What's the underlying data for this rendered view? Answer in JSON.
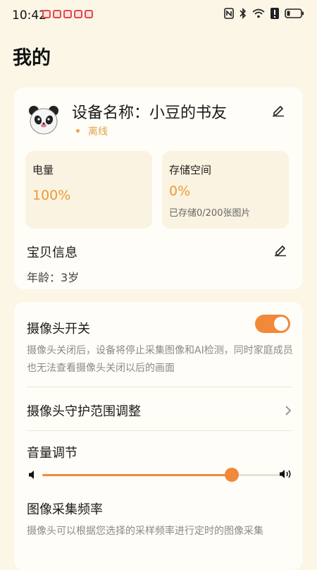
{
  "status_bar": {
    "time": "10:42",
    "icons": [
      "nfc-icon",
      "bluetooth-icon",
      "wifi-icon",
      "alert-icon",
      "battery-icon"
    ]
  },
  "page": {
    "title": "我的"
  },
  "device": {
    "name_label": "设备名称：",
    "name_value": "小豆的书友",
    "status": "离线",
    "battery_label": "电量",
    "battery_value": "100%",
    "storage_label": "存储空间",
    "storage_value": "0%",
    "storage_detail": "已存储0/200张图片"
  },
  "baby": {
    "title": "宝贝信息",
    "age": "年龄：3岁"
  },
  "settings": {
    "camera_switch_title": "摄像头开关",
    "camera_switch_on": true,
    "camera_switch_desc": "摄像头关闭后，设备将停止采集图像和AI检测，同时家庭成员也无法查看摄像头关闭以后的画面",
    "guard_range_title": "摄像头守护范围调整",
    "volume_title": "音量调节",
    "volume_level": 0.79,
    "frequency_title": "图像采集频率",
    "frequency_desc": "摄像头可以根据您选择的采样频率进行定时的图像采集"
  },
  "colors": {
    "accent": "#f2883a",
    "status": "#e0a24a",
    "background": "#fbf6e6",
    "card": "#fffdf7"
  }
}
